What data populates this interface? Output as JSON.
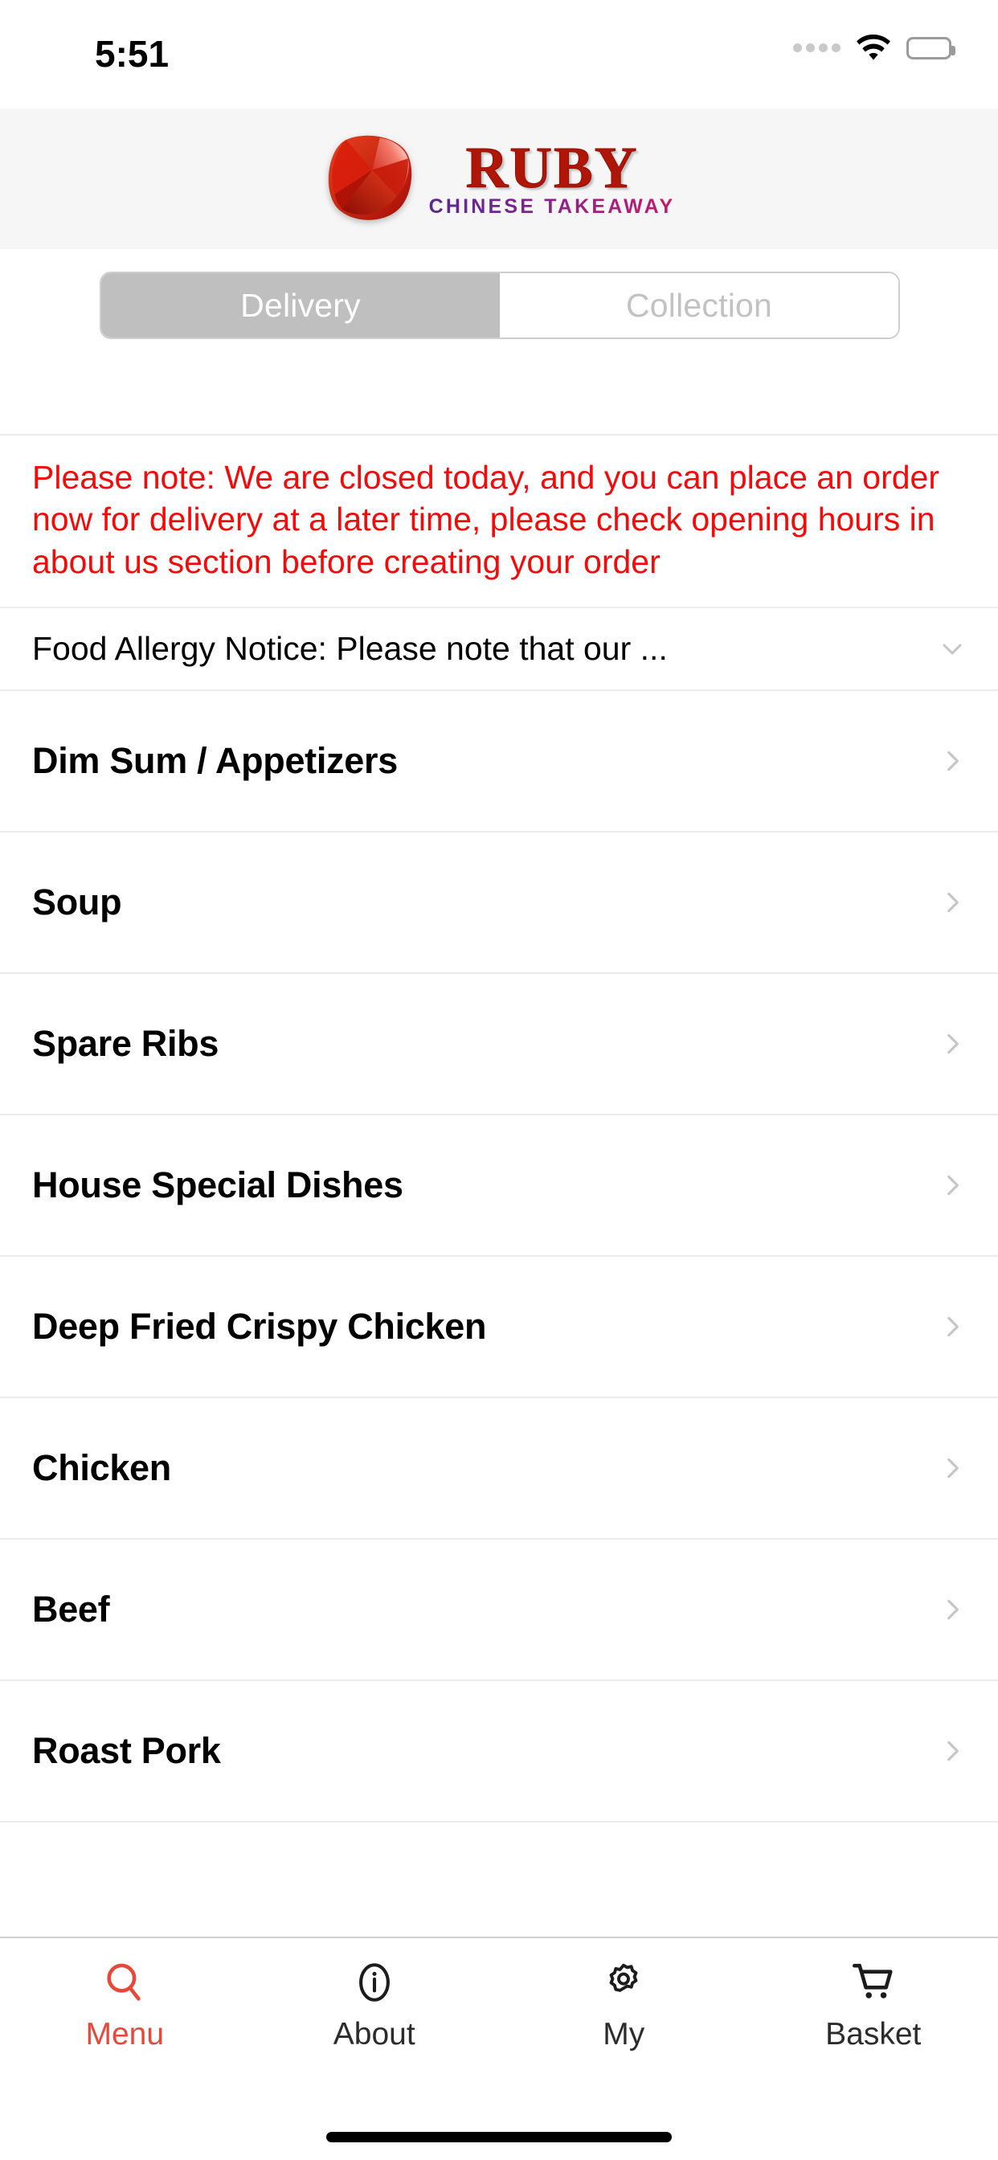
{
  "status_bar": {
    "time": "5:51",
    "signal_icon": "signal-dots-icon",
    "wifi_icon": "wifi-icon",
    "battery_icon": "battery-full-icon"
  },
  "header": {
    "logo_icon": "ruby-gem-icon",
    "brand": "RUBY",
    "tagline": "CHINESE TAKEAWAY",
    "brand_color": "#b01608",
    "tagline_color": "#7a2490",
    "background": "#f6f6f6"
  },
  "order_type": {
    "options": [
      {
        "label": "Delivery",
        "selected": true
      },
      {
        "label": "Collection",
        "selected": false
      }
    ],
    "active_background": "#bfbfbf",
    "active_text_color": "#ffffff",
    "inactive_text_color": "#c2c2c2"
  },
  "notice": {
    "text": "Please note: We are closed today, and you can place an order now for delivery at a later time, please check opening hours in about us section before creating your order",
    "color": "#f50a0a"
  },
  "allergy": {
    "text": "Food Allergy Notice: Please note that our ...",
    "chevron_icon": "chevron-down-icon"
  },
  "categories": [
    {
      "label": "Dim Sum / Appetizers",
      "chevron_icon": "chevron-right-icon"
    },
    {
      "label": "Soup",
      "chevron_icon": "chevron-right-icon"
    },
    {
      "label": "Spare Ribs",
      "chevron_icon": "chevron-right-icon"
    },
    {
      "label": "House Special Dishes",
      "chevron_icon": "chevron-right-icon"
    },
    {
      "label": "Deep Fried Crispy Chicken",
      "chevron_icon": "chevron-right-icon"
    },
    {
      "label": "Chicken",
      "chevron_icon": "chevron-right-icon"
    },
    {
      "label": "Beef",
      "chevron_icon": "chevron-right-icon"
    },
    {
      "label": "Roast Pork",
      "chevron_icon": "chevron-right-icon"
    }
  ],
  "tabbar": {
    "active_color": "#e8483a",
    "inactive_color": "#2c2c2c",
    "items": [
      {
        "label": "Menu",
        "icon": "search-icon",
        "active": true
      },
      {
        "label": "About",
        "icon": "info-icon",
        "active": false
      },
      {
        "label": "My",
        "icon": "gear-icon",
        "active": false
      },
      {
        "label": "Basket",
        "icon": "cart-icon",
        "active": false
      }
    ]
  }
}
